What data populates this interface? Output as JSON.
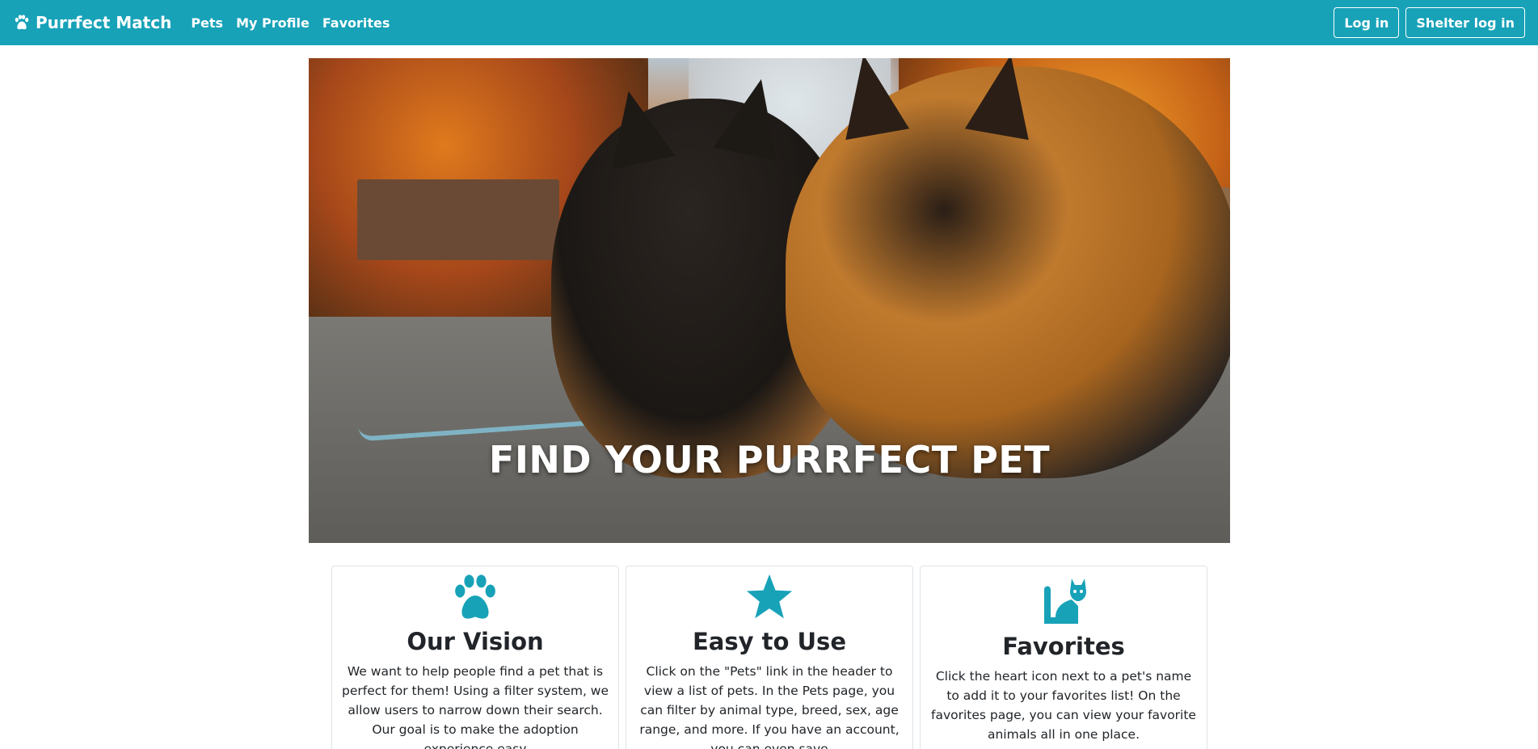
{
  "navbar": {
    "brand": "Purrfect Match",
    "links": [
      "Pets",
      "My Profile",
      "Favorites"
    ],
    "login_label": "Log in",
    "shelter_login_label": "Shelter log in",
    "color": "#17a2b8"
  },
  "hero": {
    "title": "FIND YOUR PURRFECT PET"
  },
  "cards": [
    {
      "icon": "paw-icon",
      "title": "Our Vision",
      "text": "We want to help people find a pet that is perfect for them! Using a filter system, we allow users to narrow down their search. Our goal is to make the adoption experience easy"
    },
    {
      "icon": "star-icon",
      "title": "Easy to Use",
      "text": "Click on the \"Pets\" link in the header to view a list of pets. In the Pets page, you can filter by animal type, breed, sex, age range, and more. If you have an account, you can even save"
    },
    {
      "icon": "cat-icon",
      "title": "Favorites",
      "text": "Click the heart icon next to a pet's name to add it to your favorites list! On the favorites page, you can view your favorite animals all in one place."
    }
  ],
  "accent_color": "#17a2b8"
}
